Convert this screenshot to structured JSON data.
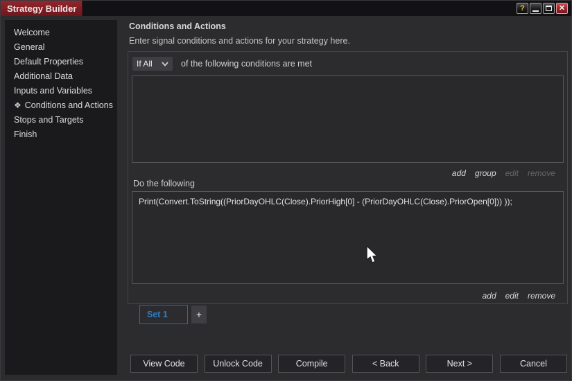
{
  "window": {
    "title": "Strategy Builder",
    "controls": {
      "help_label": "?",
      "close_glyph": "✕"
    }
  },
  "sidebar": {
    "selected_icon": "❖",
    "items": [
      {
        "label": "Welcome",
        "selected": false
      },
      {
        "label": "General",
        "selected": false
      },
      {
        "label": "Default Properties",
        "selected": false
      },
      {
        "label": "Additional Data",
        "selected": false
      },
      {
        "label": "Inputs and Variables",
        "selected": false
      },
      {
        "label": "Conditions and Actions",
        "selected": true
      },
      {
        "label": "Stops and Targets",
        "selected": false
      },
      {
        "label": "Finish",
        "selected": false
      }
    ]
  },
  "main": {
    "heading": "Conditions and Actions",
    "subtitle": "Enter signal conditions and actions for your strategy here.",
    "conditions": {
      "dropdown_value": "If All",
      "caption": "of the following conditions are met",
      "items": [],
      "links": [
        {
          "label": "add",
          "enabled": true
        },
        {
          "label": "group",
          "enabled": true
        },
        {
          "label": "edit",
          "enabled": false
        },
        {
          "label": "remove",
          "enabled": false
        }
      ]
    },
    "actions": {
      "label": "Do the following",
      "items": [
        "Print(Convert.ToString((PriorDayOHLC(Close).PriorHigh[0] - (PriorDayOHLC(Close).PriorOpen[0])) ));"
      ],
      "links": [
        {
          "label": "add",
          "enabled": true
        },
        {
          "label": "edit",
          "enabled": true
        },
        {
          "label": "remove",
          "enabled": true
        }
      ]
    },
    "tabs": {
      "active": "Set 1",
      "add_button": "+"
    }
  },
  "footer": {
    "buttons": [
      "View Code",
      "Unlock Code",
      "Compile",
      "< Back",
      "Next >",
      "Cancel"
    ]
  },
  "colors": {
    "title_tab_red": "#7d1b21",
    "accent_blue": "#2e7fc9",
    "window_bg": "#2c2c2f",
    "sidebar_bg": "#1a1a1c",
    "close_button_red": "#992027"
  }
}
